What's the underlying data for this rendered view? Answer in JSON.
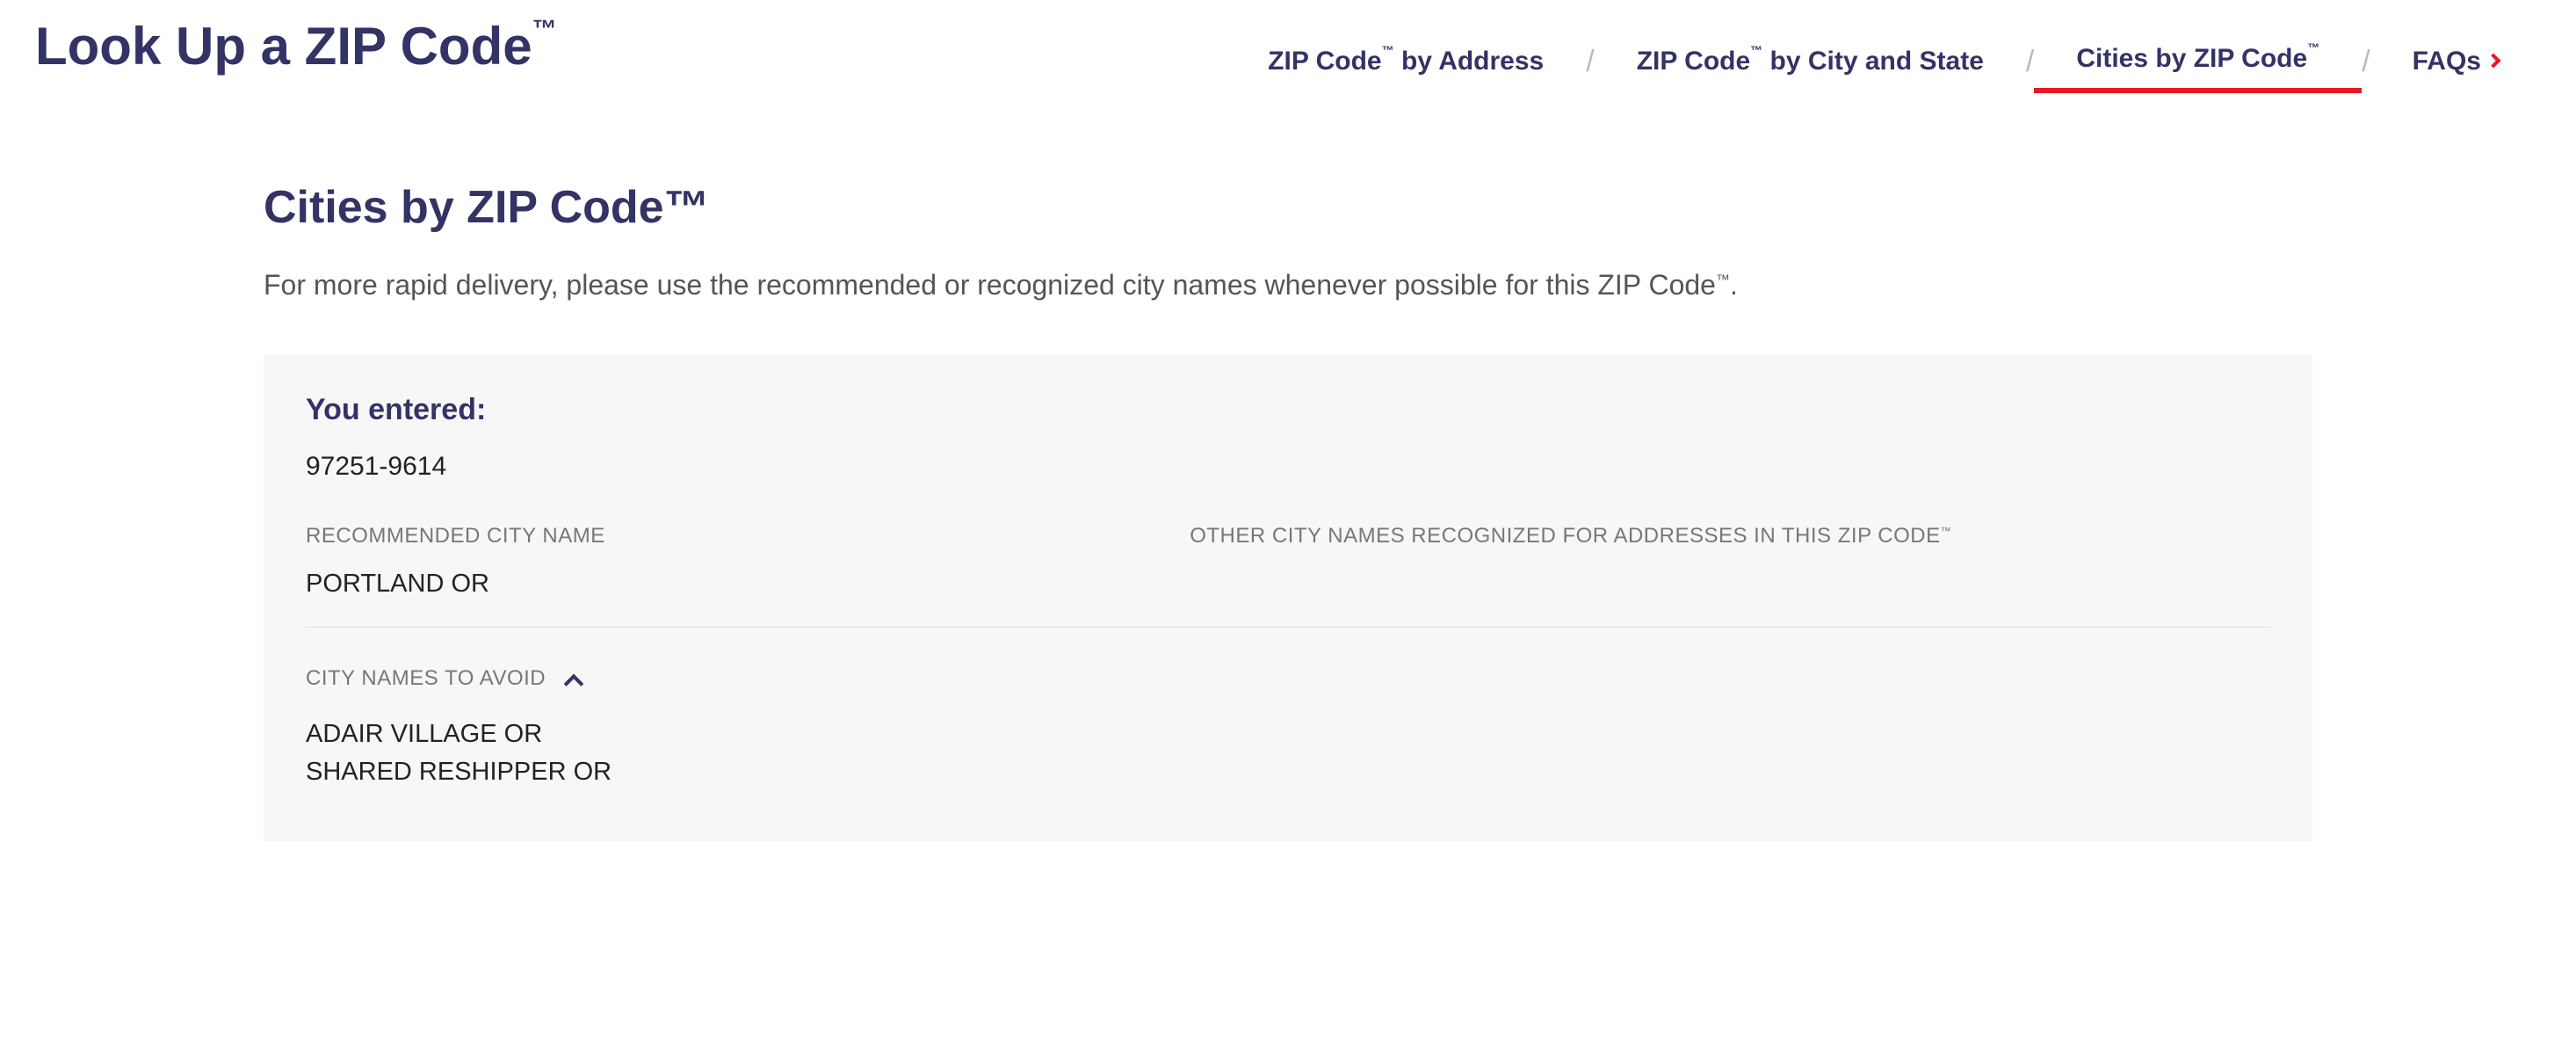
{
  "header": {
    "title": "Look Up a ZIP Code",
    "title_tm": "™"
  },
  "tabs": {
    "by_address": "ZIP Code",
    "by_address_tm": "™",
    "by_address_suffix": " by Address",
    "by_city": "ZIP Code",
    "by_city_tm": "™",
    "by_city_suffix": " by City and State",
    "cities_by_zip": "Cities by ZIP Code",
    "cities_by_zip_tm": "™",
    "faqs": "FAQs"
  },
  "content": {
    "section_title": "Cities by ZIP Code™",
    "description_prefix": "For more rapid delivery, please use the recommended or recognized city names whenever possible for this ZIP Code",
    "description_tm": "™",
    "description_suffix": "."
  },
  "result": {
    "entered_label": "You entered:",
    "entered_value": "97251-9614",
    "recommended_header": "RECOMMENDED CITY NAME",
    "recommended_value": "PORTLAND OR",
    "other_header_prefix": "OTHER CITY NAMES RECOGNIZED FOR ADDRESSES IN THIS ZIP CODE",
    "other_header_tm": "™",
    "avoid_header": "CITY NAMES TO AVOID",
    "avoid_list": [
      "ADAIR VILLAGE OR",
      "SHARED RESHIPPER OR"
    ]
  }
}
